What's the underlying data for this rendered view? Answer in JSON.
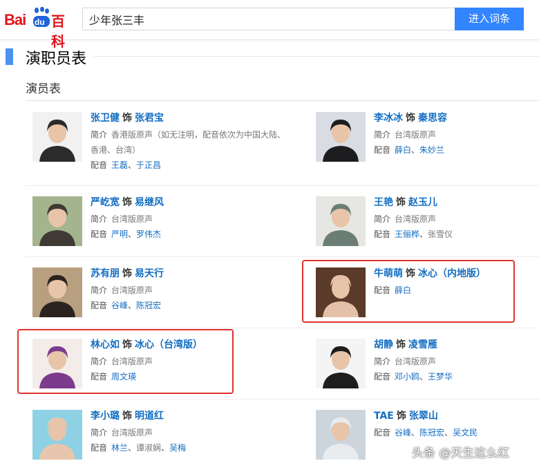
{
  "logo": {
    "bai": "Bai",
    "du": "du",
    "baike": "百科"
  },
  "search": {
    "value": "少年张三丰",
    "button": "进入词条"
  },
  "section": {
    "title": "演职员表",
    "subtitle": "演员表"
  },
  "shi": "饰",
  "labels": {
    "intro": "简介",
    "voice": "配音"
  },
  "cast": [
    {
      "actor": "张卫健",
      "role": "张君宝",
      "intro": "香港版原声（如无注明，配音依次为中国大陆、香港、台湾）",
      "voice": [
        "王磊",
        "于正昌"
      ],
      "photo_colors": [
        "#f1f1f1",
        "#2b2b2b"
      ]
    },
    {
      "actor": "李冰冰",
      "role": "秦思容",
      "intro": "台湾版原声",
      "voice": [
        "薛白",
        "朱妙兰"
      ],
      "photo_colors": [
        "#d9dde3",
        "#1d1d1f"
      ]
    },
    {
      "actor": "严屹宽",
      "role": "易继风",
      "intro": "台湾版原声",
      "voice": [
        "严明",
        "罗伟杰"
      ],
      "photo_colors": [
        "#a4b48e",
        "#3f3a34"
      ]
    },
    {
      "actor": "王艳",
      "role": "赵玉儿",
      "intro": "台湾版原声",
      "voice": [
        "王俪桦",
        "张雪仪"
      ],
      "voice_unlinked": [
        false,
        true
      ],
      "photo_colors": [
        "#e6e6e2",
        "#6b7d74"
      ]
    },
    {
      "actor": "苏有朋",
      "role": "易天行",
      "intro": "台湾版原声",
      "voice": [
        "谷峰",
        "陈冠宏"
      ],
      "photo_colors": [
        "#b89f7f",
        "#2a2320"
      ]
    },
    {
      "actor": "牛萌萌",
      "role": "冰心（内地版）",
      "intro": "",
      "voice": [
        "薛白"
      ],
      "photo_colors": [
        "#5a3a28",
        "#e5c0a8"
      ]
    },
    {
      "actor": "林心如",
      "role": "冰心（台湾版）",
      "intro": "台湾版原声",
      "voice": [
        "周文瑛"
      ],
      "photo_colors": [
        "#f3ece9",
        "#7d3b8d"
      ]
    },
    {
      "actor": "胡静",
      "role": "凌雪雁",
      "intro": "台湾版原声",
      "voice": [
        "邓小鸥",
        "王梦华"
      ],
      "photo_colors": [
        "#f4f4f4",
        "#1e1e1e"
      ]
    },
    {
      "actor": "李小璐",
      "role": "明道红",
      "intro": "台湾版原声",
      "voice": [
        "林兰",
        "谭淑娴",
        "吴梅"
      ],
      "voice_unlinked": [
        false,
        true,
        false
      ],
      "photo_colors": [
        "#8ed1e4",
        "#e7c6ad"
      ]
    },
    {
      "actor": "TAE",
      "role": "张翠山",
      "intro": "",
      "voice": [
        "谷峰",
        "陈冠宏",
        "吴文民"
      ],
      "photo_colors": [
        "#cdd5dc",
        "#e9ecef"
      ]
    }
  ],
  "watermark": "头条 @天生这么红",
  "colors": {
    "link": "#136ec2",
    "brand_red": "#e1131a",
    "search_button": "#3385ff",
    "highlight_box": "#e0312b",
    "section_bar": "#4c92f0"
  }
}
